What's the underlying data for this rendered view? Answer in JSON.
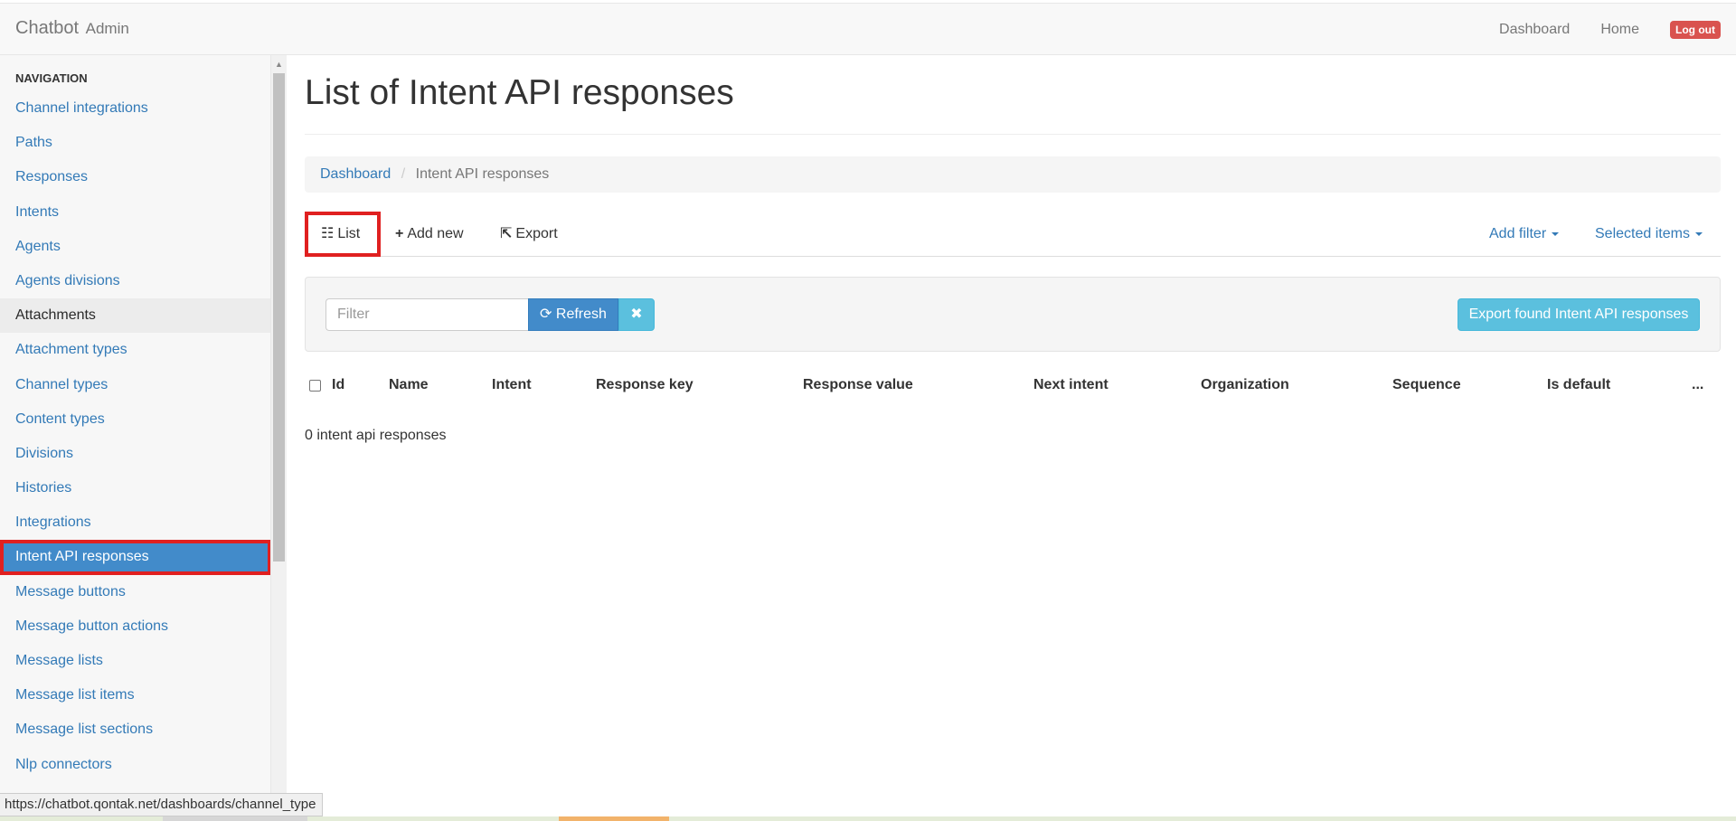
{
  "app": {
    "brand": "Chatbot",
    "brand_sub": "Admin"
  },
  "topnav": {
    "dashboard": "Dashboard",
    "home": "Home",
    "logout": "Log out"
  },
  "sidebar": {
    "heading": "Navigation",
    "items": [
      {
        "label": "Channel integrations"
      },
      {
        "label": "Paths"
      },
      {
        "label": "Responses"
      },
      {
        "label": "Intents"
      },
      {
        "label": "Agents"
      },
      {
        "label": "Agents divisions"
      },
      {
        "label": "Attachments"
      },
      {
        "label": "Attachment types"
      },
      {
        "label": "Channel types"
      },
      {
        "label": "Content types"
      },
      {
        "label": "Divisions"
      },
      {
        "label": "Histories"
      },
      {
        "label": "Integrations"
      },
      {
        "label": "Intent API responses"
      },
      {
        "label": "Message buttons"
      },
      {
        "label": "Message button actions"
      },
      {
        "label": "Message lists"
      },
      {
        "label": "Message list items"
      },
      {
        "label": "Message list sections"
      },
      {
        "label": "Nlp connectors"
      }
    ]
  },
  "main": {
    "title": "List of Intent API responses",
    "breadcrumb": {
      "root": "Dashboard",
      "current": "Intent API responses"
    },
    "tabs": {
      "list": "List",
      "add_new": "Add new",
      "export": "Export"
    },
    "dropdowns": {
      "add_filter": "Add filter",
      "selected_items": "Selected items"
    },
    "filter": {
      "placeholder": "Filter",
      "refresh": "Refresh",
      "clear": "✖",
      "export_found": "Export found Intent API responses"
    },
    "columns": [
      "Id",
      "Name",
      "Intent",
      "Response key",
      "Response value",
      "Next intent",
      "Organization",
      "Sequence",
      "Is default",
      "..."
    ],
    "empty_count": "0 intent api responses"
  },
  "statusbar": {
    "url": "https://chatbot.qontak.net/dashboards/channel_type"
  },
  "colors": {
    "primary": "#428bca",
    "info": "#5bc0de",
    "danger": "#d9534f",
    "highlight": "#e02020"
  }
}
